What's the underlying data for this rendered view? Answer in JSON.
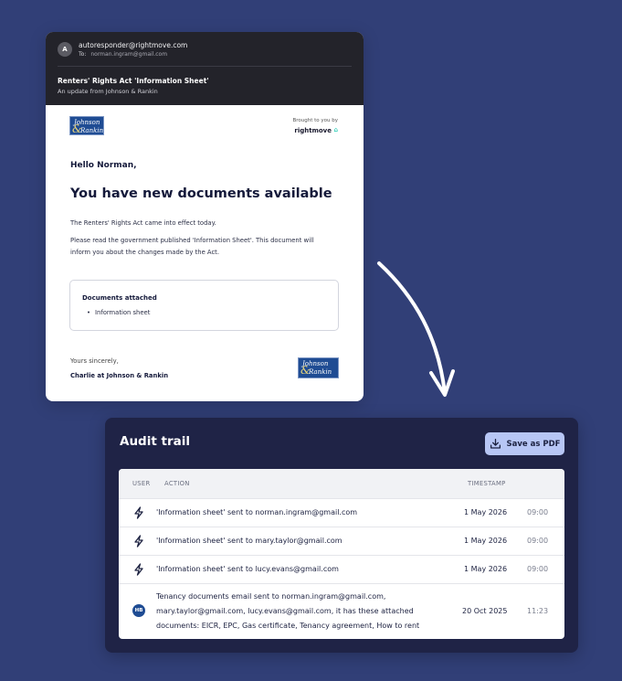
{
  "email": {
    "sender_initial": "A",
    "sender": "autoresponder@rightmove.com",
    "to_label": "To:",
    "to": "norman.ingram@gmail.com",
    "subject": "Renters' Rights Act 'Information Sheet'",
    "update_from": "An update from Johnson & Rankin",
    "logo": {
      "line1": "Johnson",
      "amp": "&",
      "line2": "Rankin"
    },
    "brought_by": "Brought to you by",
    "brought_brand": "rightmove",
    "greeting": "Hello Norman,",
    "headline": "You have new documents available",
    "para1": "The Renters' Rights Act came into effect today.",
    "para2": "Please read the government published 'Information Sheet'. This document will inform you about the changes made by the Act.",
    "docs_title": "Documents attached",
    "docs": [
      "Information sheet"
    ],
    "closing": "Yours sincerely,",
    "signoff": "Charlie at Johnson & Rankin"
  },
  "audit": {
    "title": "Audit trail",
    "save_pdf": "Save as PDF",
    "columns": {
      "user": "USER",
      "action": "ACTION",
      "timestamp": "TIMESTAMP"
    },
    "rows": [
      {
        "user_icon": "lightning-icon",
        "action": "'Information sheet' sent to norman.ingram@gmail.com",
        "date": "1 May 2026",
        "time": "09:00"
      },
      {
        "user_icon": "lightning-icon",
        "action": "'Information sheet' sent to mary.taylor@gmail.com",
        "date": "1 May 2026",
        "time": "09:00"
      },
      {
        "user_icon": "lightning-icon",
        "action": "'Information sheet' sent to lucy.evans@gmail.com",
        "date": "1 May 2026",
        "time": "09:00"
      },
      {
        "user_initials": "HB",
        "action_lines": [
          "Tenancy documents email sent to norman.ingram@gmail.com,",
          "mary.taylor@gmail.com, lucy.evans@gmail.com, it has these attached",
          "documents: EICR, EPC, Gas certificate, Tenancy agreement, How to rent"
        ],
        "date": "20 Oct 2025",
        "time": "11:23"
      }
    ]
  },
  "colors": {
    "background": "#313f77",
    "panel": "#1f2346",
    "button": "#b7c6f5",
    "logo": "#1f4c93"
  }
}
